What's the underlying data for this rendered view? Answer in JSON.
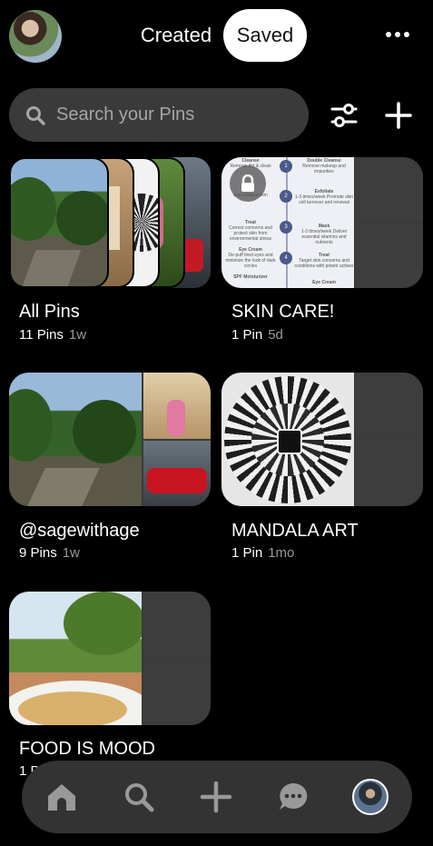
{
  "header": {
    "tabs": [
      {
        "label": "Created",
        "active": false
      },
      {
        "label": "Saved",
        "active": true
      }
    ]
  },
  "search": {
    "placeholder": "Search your Pins"
  },
  "boards": [
    {
      "title": "All Pins",
      "count": "11 Pins",
      "time": "1w"
    },
    {
      "title": "SKIN CARE!",
      "count": "1 Pin",
      "time": "5d",
      "locked": true
    },
    {
      "title": "@sagewithage",
      "count": "9 Pins",
      "time": "1w"
    },
    {
      "title": "MANDALA ART",
      "count": "1 Pin",
      "time": "1mo"
    },
    {
      "title": "FOOD IS MOOD",
      "count": "1 P",
      "time": ""
    }
  ],
  "skincare_sheet": {
    "left": [
      {
        "heading": "Cleanse",
        "text": "Remove dirt & clean"
      },
      {
        "heading": "",
        "text": "and balance skin"
      },
      {
        "heading": "Treat",
        "text": "Correct concerns and protect skin from environmental stress"
      },
      {
        "heading": "Eye Cream",
        "text": "De-puff tired eyes and minimize the look of dark circles"
      },
      {
        "heading": "SPF Moisturizer",
        "text": ""
      }
    ],
    "steps": [
      "1",
      "2",
      "3",
      "4"
    ],
    "right": [
      {
        "heading": "Double Cleanse",
        "text": "Remove makeup and impurities"
      },
      {
        "heading": "Exfoliate",
        "text": "1-3 times/week Promote skin cell turnover and renewal"
      },
      {
        "heading": "Mask",
        "text": "1-3 times/week Deliver essential vitamins and nutrients"
      },
      {
        "heading": "Treat",
        "text": "Target skin concerns and conditions with potent actives"
      },
      {
        "heading": "Eye Cream",
        "text": ""
      }
    ]
  },
  "icons": {
    "more": "more-dots-icon",
    "search": "search-icon",
    "filter": "filter-sliders-icon",
    "add": "plus-icon",
    "lock": "lock-icon",
    "nav": [
      "home-icon",
      "search-icon",
      "plus-icon",
      "chat-icon",
      "profile-avatar"
    ]
  },
  "colors": {
    "background": "#000000",
    "surface": "#3a3a3a",
    "active_tab": "#ffffff",
    "muted_text": "#9a9a9a"
  }
}
